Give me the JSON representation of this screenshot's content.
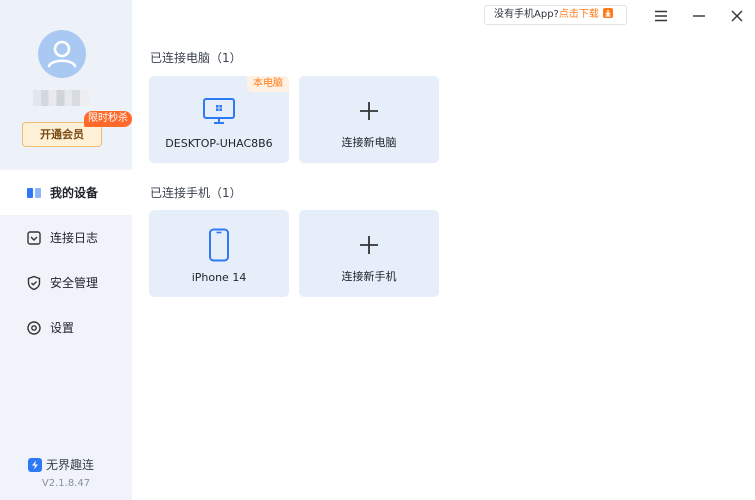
{
  "sidebar": {
    "vip_button": "开通会员",
    "vip_badge": "限时秒杀",
    "nav": [
      {
        "label": "我的设备"
      },
      {
        "label": "连接日志"
      },
      {
        "label": "安全管理"
      },
      {
        "label": "设置"
      }
    ],
    "brand": "无界趣连",
    "version": "V2.1.8.47"
  },
  "topbar": {
    "promo_text": "没有手机App?",
    "promo_link": "点击下载"
  },
  "main": {
    "pc_section": "已连接电脑（1）",
    "pc_cards": [
      {
        "label": "DESKTOP-UHAC8B6",
        "tag": "本电脑",
        "icon": "monitor-icon"
      },
      {
        "label": "连接新电脑",
        "icon": "plus-icon"
      }
    ],
    "phone_section": "已连接手机（1）",
    "phone_cards": [
      {
        "label": "iPhone 14",
        "icon": "phone-icon"
      },
      {
        "label": "连接新手机",
        "icon": "plus-icon"
      }
    ]
  },
  "colors": {
    "accent": "#2d79f6",
    "card_bg": "#e6eefa",
    "orange": "#ff7a1a"
  }
}
